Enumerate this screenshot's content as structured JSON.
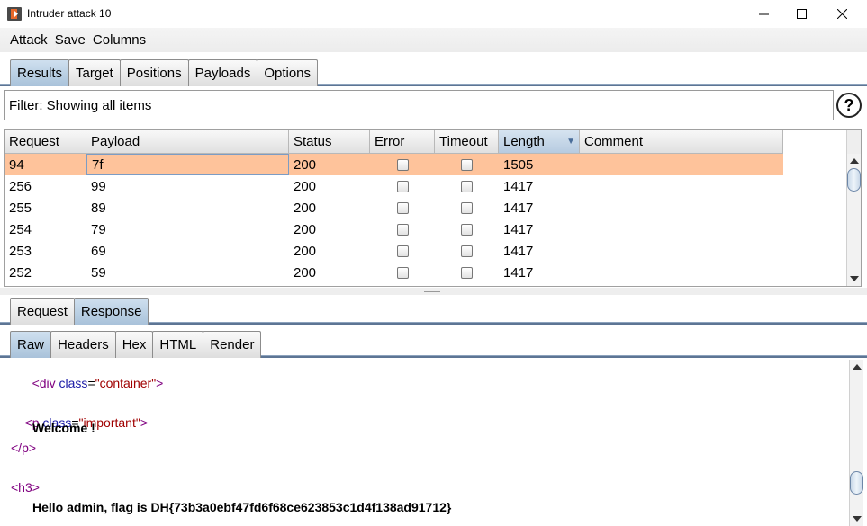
{
  "window": {
    "title": "Intruder attack 10"
  },
  "menu": [
    "Attack",
    "Save",
    "Columns"
  ],
  "main_tabs": [
    "Results",
    "Target",
    "Positions",
    "Payloads",
    "Options"
  ],
  "filter": {
    "label": "Filter: Showing all items",
    "help": "?"
  },
  "table": {
    "columns": [
      "Request",
      "Payload",
      "Status",
      "Error",
      "Timeout",
      "Length",
      "Comment"
    ],
    "sorted_column": "Length",
    "rows": [
      {
        "request": "94",
        "payload": "7f",
        "status": "200",
        "error": false,
        "timeout": false,
        "length": "1505",
        "comment": ""
      },
      {
        "request": "256",
        "payload": "99",
        "status": "200",
        "error": false,
        "timeout": false,
        "length": "1417",
        "comment": ""
      },
      {
        "request": "255",
        "payload": "89",
        "status": "200",
        "error": false,
        "timeout": false,
        "length": "1417",
        "comment": ""
      },
      {
        "request": "254",
        "payload": "79",
        "status": "200",
        "error": false,
        "timeout": false,
        "length": "1417",
        "comment": ""
      },
      {
        "request": "253",
        "payload": "69",
        "status": "200",
        "error": false,
        "timeout": false,
        "length": "1417",
        "comment": ""
      },
      {
        "request": "252",
        "payload": "59",
        "status": "200",
        "error": false,
        "timeout": false,
        "length": "1417",
        "comment": ""
      }
    ]
  },
  "detail_tabs": [
    "Request",
    "Response"
  ],
  "view_tabs": [
    "Raw",
    "Headers",
    "Hex",
    "HTML",
    "Render"
  ],
  "response": {
    "l1_open": "<div ",
    "l1_attr": "class",
    "l1_eq": "=",
    "l1_val": "\"container\"",
    "l1_close": ">",
    "l2_open": "<p ",
    "l2_attr": "class",
    "l2_eq": "=",
    "l2_val": "\"important\"",
    "l2_close": ">",
    "l3": "Welcome !",
    "l4": "</p>",
    "l5": "<h3>",
    "l6": "Hello admin, flag is DH{73b3a0ebf47fd6f68ce623853c1d4f138ad91712}"
  },
  "colors": {
    "selected_row": "#fec39b",
    "active_tab": "#b9cfe4",
    "tab_line": "#5d7594"
  }
}
